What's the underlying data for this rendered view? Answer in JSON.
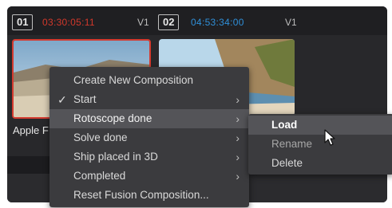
{
  "header": {
    "clip1": {
      "number": "01",
      "timecode": "03:30:05:11",
      "track": "V1"
    },
    "clip2": {
      "number": "02",
      "timecode": "04:53:34:00",
      "track": "V1"
    }
  },
  "clip1_name": "Apple F",
  "context_menu": {
    "items": [
      {
        "label": "Create New Composition",
        "checked": false,
        "has_submenu": false
      },
      {
        "label": "Start",
        "checked": true,
        "has_submenu": true
      },
      {
        "label": "Rotoscope done",
        "checked": false,
        "has_submenu": true,
        "highlighted": true
      },
      {
        "label": "Solve done",
        "checked": false,
        "has_submenu": true
      },
      {
        "label": "Ship placed in 3D",
        "checked": false,
        "has_submenu": true
      },
      {
        "label": "Completed",
        "checked": false,
        "has_submenu": true
      },
      {
        "label": "Reset Fusion Composition...",
        "checked": false,
        "has_submenu": false
      }
    ],
    "check_glyph": "✓",
    "submenu_arrow": "›"
  },
  "submenu": {
    "items": [
      {
        "label": "Load",
        "active": true
      },
      {
        "label": "Rename"
      },
      {
        "label": "Delete"
      }
    ]
  },
  "colors": {
    "timecode_red": "#d3382b",
    "timecode_blue": "#2f8fd8",
    "selection_border": "#d43a2f"
  },
  "icons": {
    "check": "check-icon",
    "submenu": "chevron-right-icon",
    "cursor": "mouse-pointer-icon"
  }
}
